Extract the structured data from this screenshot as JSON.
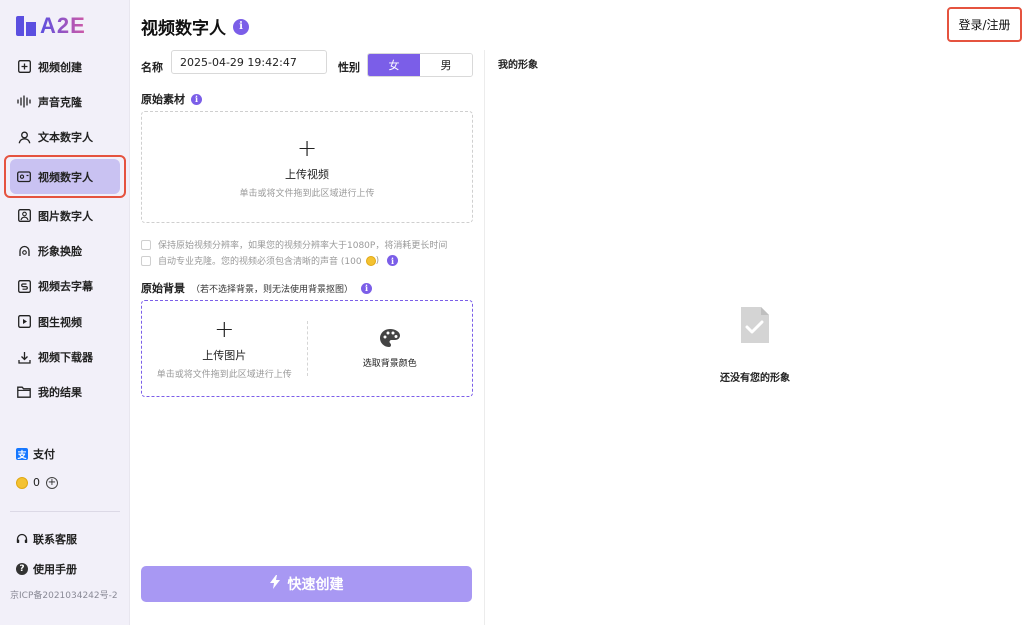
{
  "brand": {
    "logo_text": "A2E"
  },
  "sidebar": {
    "items": [
      {
        "label": "视频创建",
        "icon": "plus-square-icon"
      },
      {
        "label": "声音克隆",
        "icon": "waveform-icon"
      },
      {
        "label": "文本数字人",
        "icon": "person-icon"
      },
      {
        "label": "视频数字人",
        "icon": "video-person-icon",
        "active": true
      },
      {
        "label": "图片数字人",
        "icon": "image-person-icon"
      },
      {
        "label": "形象换脸",
        "icon": "face-swap-icon"
      },
      {
        "label": "视频去字幕",
        "icon": "remove-subtitle-icon"
      },
      {
        "label": "图生视频",
        "icon": "image-to-video-icon"
      },
      {
        "label": "视频下载器",
        "icon": "download-icon"
      },
      {
        "label": "我的结果",
        "icon": "folder-icon"
      }
    ],
    "pay_label": "支付",
    "coin_count": "0",
    "support_label": "联系客服",
    "manual_label": "使用手册",
    "icp": "京ICP备2021034242号-2"
  },
  "header": {
    "title": "视频数字人",
    "login_label": "登录/注册"
  },
  "form": {
    "name_label": "名称",
    "name_value": "2025-04-29 19:42:47",
    "gender_label": "性别",
    "gender_options": [
      "女",
      "男"
    ],
    "gender_selected": "女",
    "source_label": "原始素材",
    "upload_video_title": "上传视频",
    "upload_hint": "单击或将文件拖到此区域进行上传",
    "option_keep_resolution": "保持原始视频分辨率，如果您的视频分辨率大于1080P，将消耗更长时间",
    "option_auto_clone": "自动专业克隆。您的视频必须包含清晰的声音 (100",
    "option_auto_clone_suffix": ")",
    "bg_label": "原始背景",
    "bg_sub": "（若不选择背景，则无法使用背景抠图）",
    "upload_image_title": "上传图片",
    "pick_color_label": "选取背景颜色",
    "create_label": "快速创建"
  },
  "right": {
    "title": "我的形象",
    "empty_text": "还没有您的形象"
  },
  "colors": {
    "accent": "#7b5ee8",
    "create_button": "#a898f3",
    "highlight": "#e5533f"
  }
}
